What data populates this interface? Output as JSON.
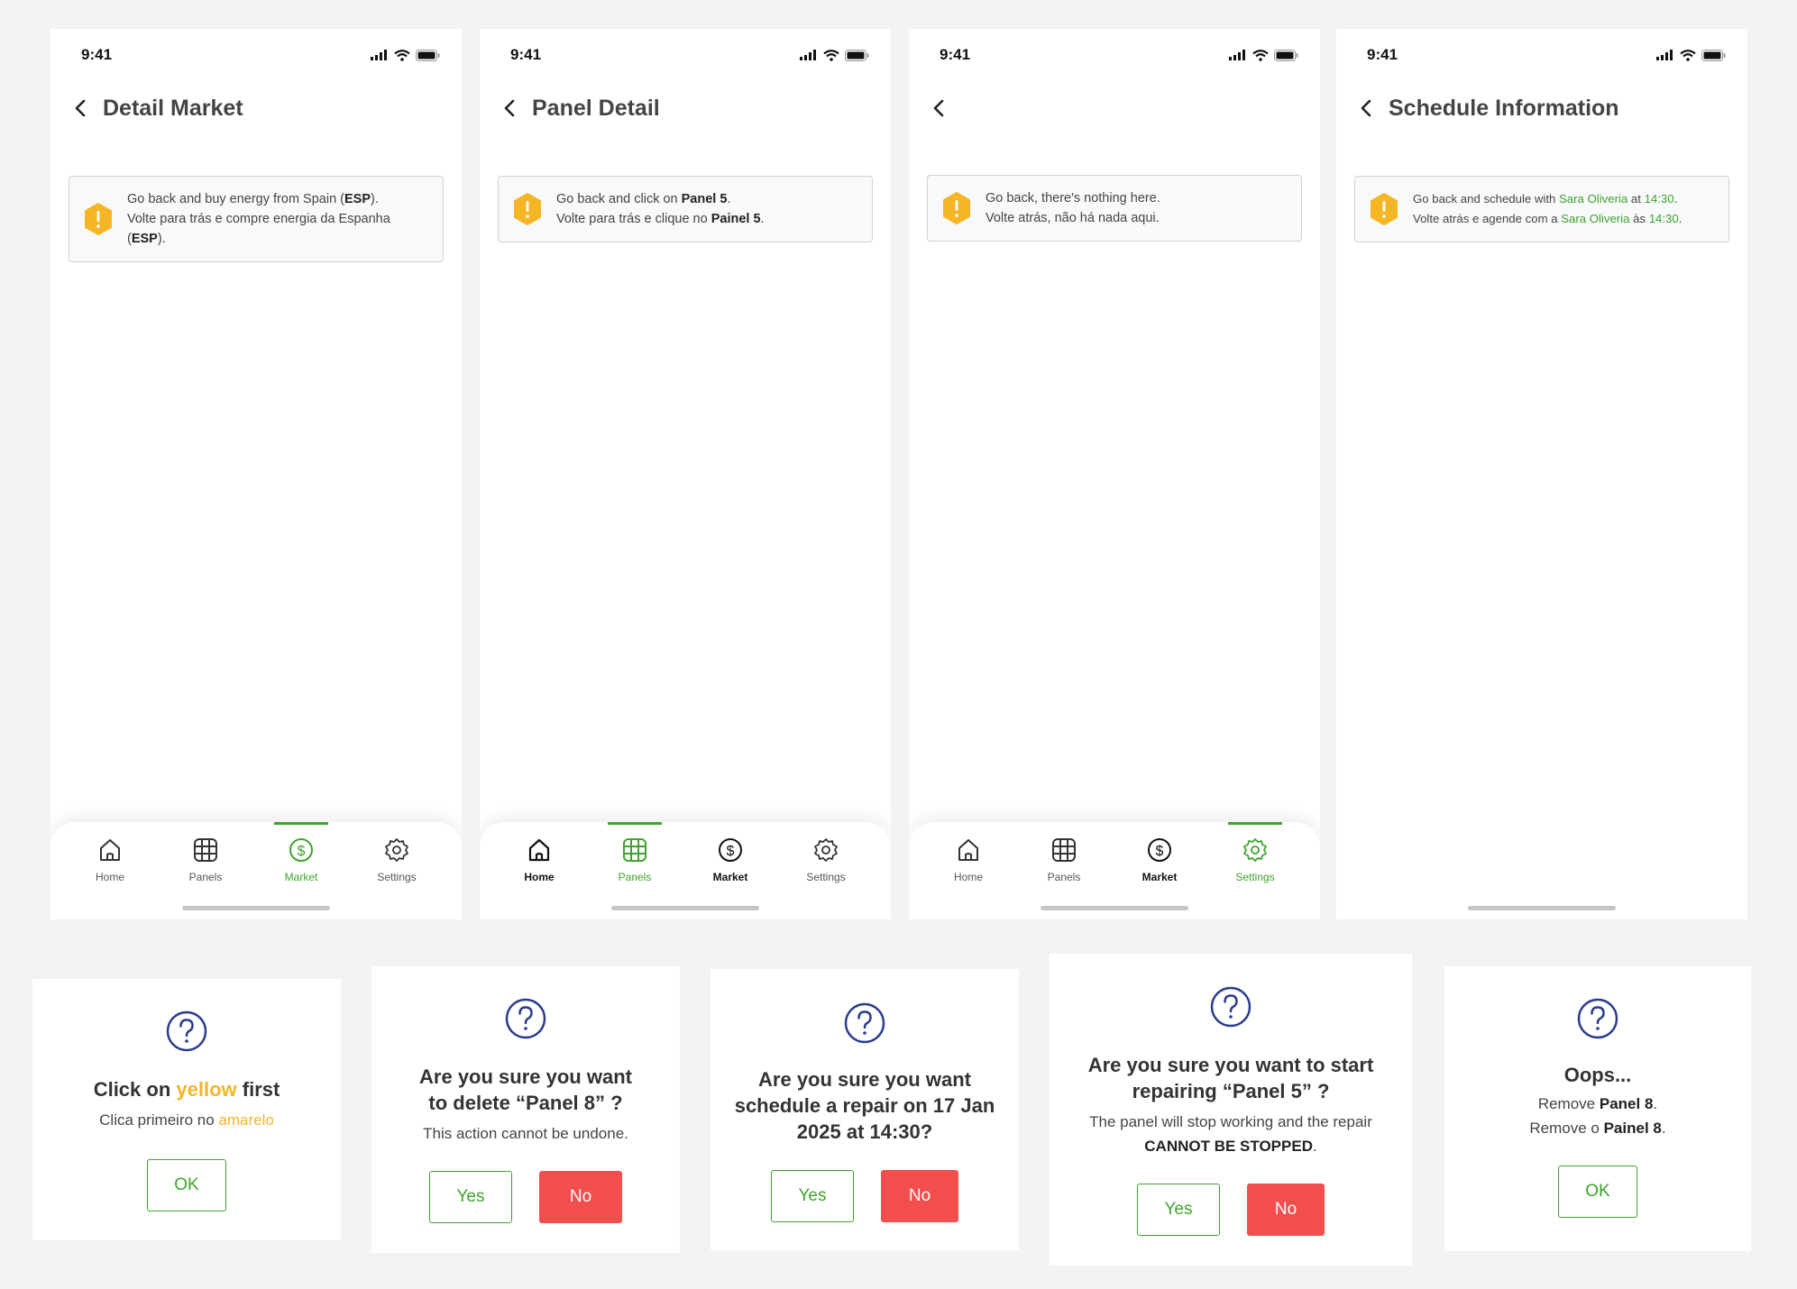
{
  "colors": {
    "accent": "#3ea32c",
    "warning": "#f5b626",
    "danger": "#f24e4e",
    "dialog_icon": "#2c3b8e",
    "background": "#f3f3f3"
  },
  "status_bar": {
    "time": "9:41"
  },
  "tab_labels": {
    "home": "Home",
    "panels": "Panels",
    "market": "Market",
    "settings": "Settings"
  },
  "screens": [
    {
      "title": "Detail Market",
      "active_tab": "market",
      "alert": {
        "en_prefix": "Go back and buy energy from Spain (",
        "en_code": "ESP",
        "en_suffix": ").",
        "pt_prefix": "Volte para trás e compre energia da Espanha (",
        "pt_code": "ESP",
        "pt_suffix": ")."
      }
    },
    {
      "title": "Panel Detail",
      "active_tab": "panels",
      "alert": {
        "en_prefix": "Go back and click on ",
        "en_target": "Panel 5",
        "en_suffix": ".",
        "pt_prefix": "Volte para trás e clique no ",
        "pt_target": "Painel 5",
        "pt_suffix": "."
      }
    },
    {
      "title": "",
      "active_tab": "settings",
      "alert": {
        "en": "Go back, there's nothing here.",
        "pt": "Volte atrás, não há nada aqui."
      }
    },
    {
      "title": "Schedule Information",
      "active_tab": "",
      "alert": {
        "en_prefix": "Go back and schedule with ",
        "en_name": "Sara Oliveria",
        "en_mid": " at ",
        "en_time": "14:30",
        "en_suffix": ".",
        "pt_prefix": "Volte atrás e agende com a ",
        "pt_name": "Sara Oliveria",
        "pt_mid": " às ",
        "pt_time": "14:30",
        "pt_suffix": "."
      }
    }
  ],
  "dialogs": {
    "click_yellow": {
      "title_prefix": "Click on ",
      "title_highlight": "yellow",
      "title_suffix": " first",
      "sub_prefix": "Clica primeiro no ",
      "sub_highlight": "amarelo",
      "ok": "OK"
    },
    "delete_panel": {
      "title": "Are you sure you want to delete “Panel 8” ?",
      "sub": "This action cannot be undone.",
      "yes": "Yes",
      "no": "No"
    },
    "schedule_repair": {
      "title": "Are you sure you want schedule a repair on 17 Jan 2025 at 14:30?",
      "yes": "Yes",
      "no": "No"
    },
    "start_repair": {
      "title": "Are you sure you want to start repairing “Panel 5” ?",
      "sub_prefix": "The panel will stop working and the repair ",
      "sub_bold": "CANNOT BE STOPPED",
      "sub_suffix": ".",
      "yes": "Yes",
      "no": "No"
    },
    "oops": {
      "title": "Oops...",
      "line1_prefix": "Remove ",
      "line1_bold": "Panel 8",
      "line1_suffix": ".",
      "line2_prefix": "Remove o ",
      "line2_bold": "Painel 8",
      "line2_suffix": ".",
      "ok": "OK"
    }
  }
}
